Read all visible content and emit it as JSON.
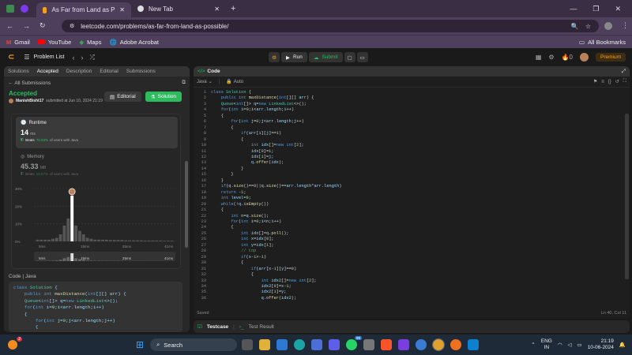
{
  "browser": {
    "tabs": [
      {
        "label": "As Far from Land as Possible - L"
      },
      {
        "label": "New Tab"
      }
    ],
    "url": "leetcode.com/problems/as-far-from-land-as-possible/",
    "bookmarks": [
      "Gmail",
      "YouTube",
      "Maps",
      "Adobe Acrobat"
    ],
    "all_bookmarks": "All Bookmarks"
  },
  "nav": {
    "problem_list": "Problem List",
    "run": "Run",
    "submit": "Submit",
    "premium": "Premium",
    "fire_count": "0"
  },
  "left": {
    "tabs": [
      "Solutions",
      "Accepted",
      "Description",
      "Editorial",
      "Submissions"
    ],
    "all_submissions": "All Submissions",
    "status": "Accepted",
    "user": "ManishBisht17",
    "submitted": "submitted at Jun 10, 2024 21:19",
    "editorial_btn": "Editorial",
    "solution_btn": "Solution",
    "runtime_label": "Runtime",
    "runtime_value": "14",
    "runtime_unit": "ms",
    "runtime_beats_label": "Beats",
    "runtime_beats_pct": "70.93%",
    "runtime_beats_suffix": "of users with Java",
    "memory_label": "Memory",
    "memory_value": "45.33",
    "memory_unit": "MB",
    "memory_beats_label": "Beats",
    "memory_beats_pct": "29.57%",
    "memory_beats_suffix": "of users with Java",
    "lang_header": "Code | Java",
    "code_lines": [
      "class Solution {",
      "    public int maxDistance(int[][] arr) {",
      "    Queue<int[]> q=new LinkedList<>();",
      "    for(int i=0;i<arr.length;i++)",
      "    {",
      "        for(int j=0;j<arr.length;j++)",
      "        {"
    ]
  },
  "chart_data": {
    "type": "bar",
    "ylabel": "",
    "xlabel": "",
    "y_ticks": [
      "30%",
      "20%",
      "10%",
      "0%"
    ],
    "x_ticks": [
      "5ms",
      "15ms",
      "25ms",
      "41ms"
    ],
    "mini_x_ticks": [
      "5ms",
      "15ms",
      "25ms",
      "41ms"
    ],
    "values": [
      1,
      1,
      1,
      1,
      1.5,
      2,
      4,
      9,
      13,
      26,
      9,
      6,
      4,
      2,
      1.5,
      1,
      1,
      1,
      1,
      0.8,
      0.8,
      0.8,
      0.8,
      0.6,
      0.6,
      0.6,
      0.6,
      0.6,
      0.5,
      0.5,
      0.5,
      0.5,
      0.5,
      0.4,
      0.4,
      0.4
    ],
    "highlight_index": 9,
    "ylim": [
      0,
      30
    ]
  },
  "editor": {
    "title": "Code",
    "language": "Java",
    "mode": "Auto",
    "saved": "Saved",
    "cursor": "Ln 40, Col 11",
    "lines": [
      "class Solution {",
      "    public int maxDistance(int[][] arr) {",
      "    Queue<int[]> q=new LinkedList<>();",
      "    for(int i=0;i<arr.length;i++)",
      "    {",
      "        for(int j=0;j<arr.length;j++)",
      "        {",
      "            if(arr[i][j]==1)",
      "            {",
      "                int idx[]=new int[2];",
      "                idx[0]=i;",
      "                idx[1]=j;",
      "                q.offer(idx);",
      "            }",
      "        }",
      "    }",
      "    if(q.size()==0||q.size()==arr.length*arr.length)",
      "    return -1;",
      "    int level=0;",
      "    while(!q.isEmpty())",
      "    {",
      "        int n=q.size();",
      "        for(int i=0;i<n;i++)",
      "        {",
      "            int idx[]=q.poll();",
      "            int x=idx[0];",
      "            int y=idx[1];",
      "            // top",
      "            if(x-1>-1)",
      "            {",
      "                if(arr[x-1][y]==0)",
      "                {",
      "                    int idx2[]=new int[2];",
      "                    idx2[0]=x-1;",
      "                    idx2[1]=y;",
      "                    q.offer(idx2);"
    ]
  },
  "bottom": {
    "testcase": "Testcase",
    "result": "Test Result"
  },
  "taskbar": {
    "search": "Search",
    "lang": "ENG",
    "region": "IN",
    "time": "21:19",
    "date": "10-06-2024",
    "notif_count": "2",
    "wa_count": "99"
  }
}
